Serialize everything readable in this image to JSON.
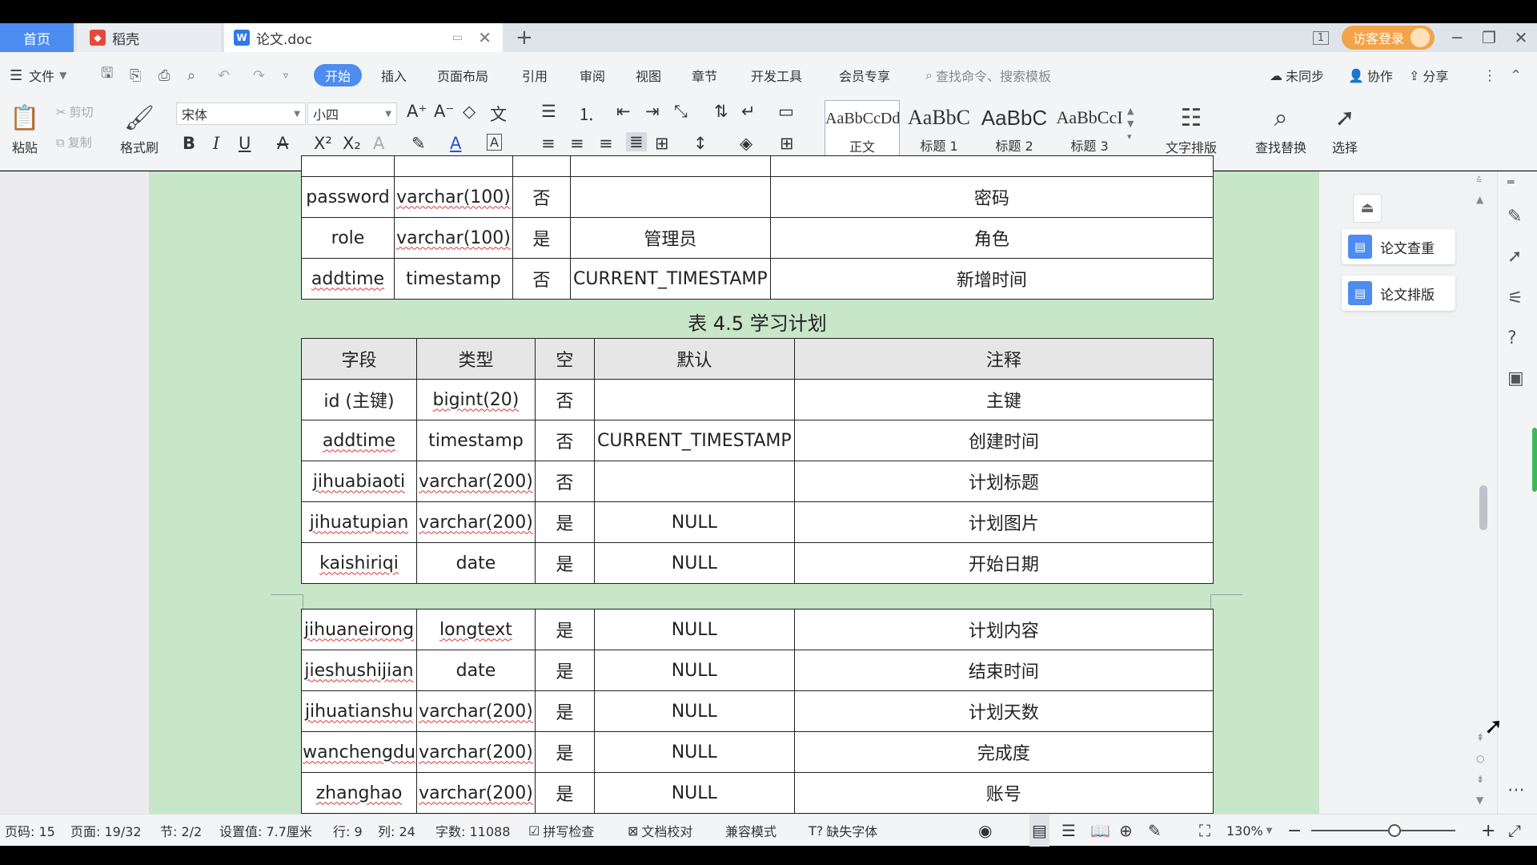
{
  "tabs": {
    "home": "首页",
    "daoke": "稻壳",
    "doc": "论文.doc",
    "new": "+"
  },
  "titlebar": {
    "login": "访客登录",
    "minimize": "─",
    "restore": "❐",
    "close": "✕"
  },
  "menu": {
    "file": "文件",
    "items": [
      "开始",
      "插入",
      "页面布局",
      "引用",
      "审阅",
      "视图",
      "章节",
      "开发工具",
      "会员专享"
    ],
    "search": "查找命令、搜索模板",
    "sync": "未同步",
    "collab": "协作",
    "share": "分享"
  },
  "ribbon": {
    "paste": "粘贴",
    "cut": "剪切",
    "copy": "复制",
    "format_painter": "格式刷",
    "font_name": "宋体",
    "font_size": "小四",
    "styles": [
      {
        "preview": "AaBbCcDd",
        "label": "正文"
      },
      {
        "preview": "AaBbC",
        "label": "标题 1"
      },
      {
        "preview": "AaBbC",
        "label": "标题 2"
      },
      {
        "preview": "AaBbCcI",
        "label": "标题 3"
      }
    ],
    "text_layout": "文字排版",
    "find_replace": "查找替换",
    "select": "选择"
  },
  "table_prev": {
    "rows": [
      [
        "password",
        "varchar(100)",
        "否",
        "",
        "密码"
      ],
      [
        "role",
        "varchar(100)",
        "是",
        "管理员",
        "角色"
      ],
      [
        "addtime",
        "timestamp",
        "否",
        "CURRENT_TIMESTAMP",
        "新增时间"
      ]
    ]
  },
  "caption": "表 4.5  学习计划",
  "table_plan": {
    "headers": [
      "字段",
      "类型",
      "空",
      "默认",
      "注释"
    ],
    "rows": [
      [
        "id (主键)",
        "bigint(20)",
        "否",
        "",
        "主键"
      ],
      [
        "addtime",
        "timestamp",
        "否",
        "CURRENT_TIMESTAMP",
        "创建时间"
      ],
      [
        "jihuabiaoti",
        "varchar(200)",
        "否",
        "",
        "计划标题"
      ],
      [
        "jihuatupian",
        "varchar(200)",
        "是",
        "NULL",
        "计划图片"
      ],
      [
        "kaishiriqi",
        "date",
        "是",
        "NULL",
        "开始日期"
      ]
    ],
    "rows_cont": [
      [
        "jihuaneirong",
        "longtext",
        "是",
        "NULL",
        "计划内容"
      ],
      [
        "jieshushijian",
        "date",
        "是",
        "NULL",
        "结束时间"
      ],
      [
        "jihuatianshu",
        "varchar(200)",
        "是",
        "NULL",
        "计划天数"
      ],
      [
        "wanchengdu",
        "varchar(200)",
        "是",
        "NULL",
        "完成度"
      ],
      [
        "zhanghao",
        "varchar(200)",
        "是",
        "NULL",
        "账号"
      ]
    ]
  },
  "right_panel": {
    "check": "论文查重",
    "format": "论文排版"
  },
  "status": {
    "page_code": "页码: 15",
    "page": "页面: 19/32",
    "section": "节: 2/2",
    "setting": "设置值: 7.7厘米",
    "row": "行: 9",
    "col": "列: 24",
    "words": "字数: 11088",
    "spell": "拼写检查",
    "proof": "文档校对",
    "compat": "兼容模式",
    "missing_font": "缺失字体",
    "zoom": "130%"
  }
}
